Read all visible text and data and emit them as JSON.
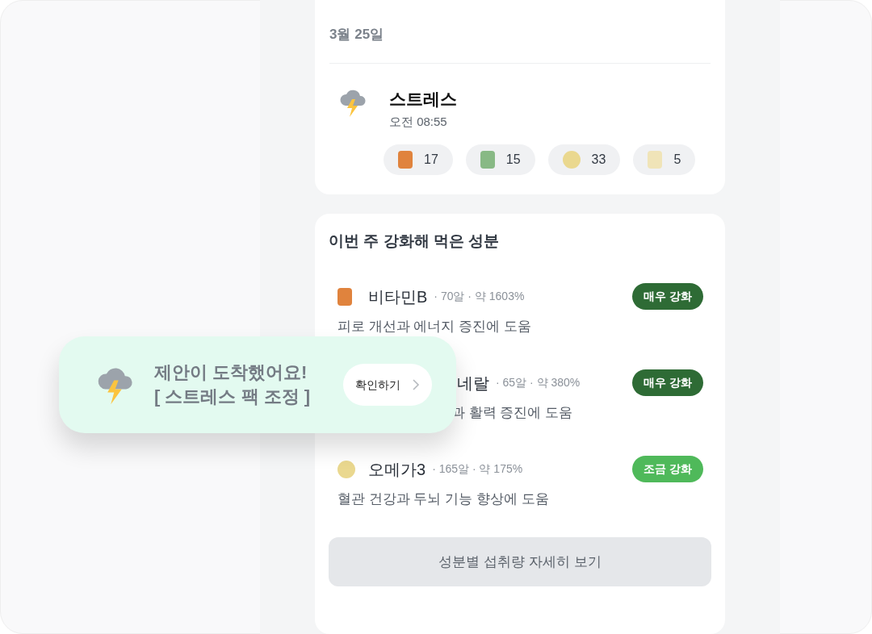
{
  "date": "3월 25일",
  "entry": {
    "title": "스트레스",
    "time": "오전 08:55",
    "chips": [
      {
        "value": "17",
        "color": "#e0833d",
        "kind": "square"
      },
      {
        "value": "15",
        "color": "#88b985",
        "kind": "square"
      },
      {
        "value": "33",
        "color": "#ead88f",
        "kind": "circle"
      },
      {
        "value": "5",
        "color": "#f0e4b8",
        "kind": "square"
      }
    ]
  },
  "nutrients": {
    "title": "이번 주 강화해 먹은 성분",
    "items": [
      {
        "kind": "square",
        "name": "비타민B",
        "meta": "· 70알 · 약 1603%",
        "badge": {
          "label": "매우 강화",
          "color": "#2e6b35"
        },
        "color": "#e0833d",
        "description": "피로 개선과 에너지 증진에 도움"
      },
      {
        "kind": "covered",
        "name": "네랄",
        "meta": "· 65알 · 약 380%",
        "badge": {
          "label": "매우 강화",
          "color": "#2e6b35"
        },
        "description": "과 활력 증진에 도움"
      },
      {
        "kind": "circle",
        "name": "오메가3",
        "meta": "· 165알 · 약 175%",
        "badge": {
          "label": "조금 강화",
          "color": "#4fb95a"
        },
        "color": "#ead88f",
        "description": "혈관 건강과 두뇌 기능 향상에 도움"
      }
    ],
    "button": "성분별 섭취량 자세히 보기"
  },
  "toast": {
    "title": "제안이 도착했어요!",
    "subtitle": "[ 스트레스 팩 조정 ]",
    "action": "확인하기"
  }
}
